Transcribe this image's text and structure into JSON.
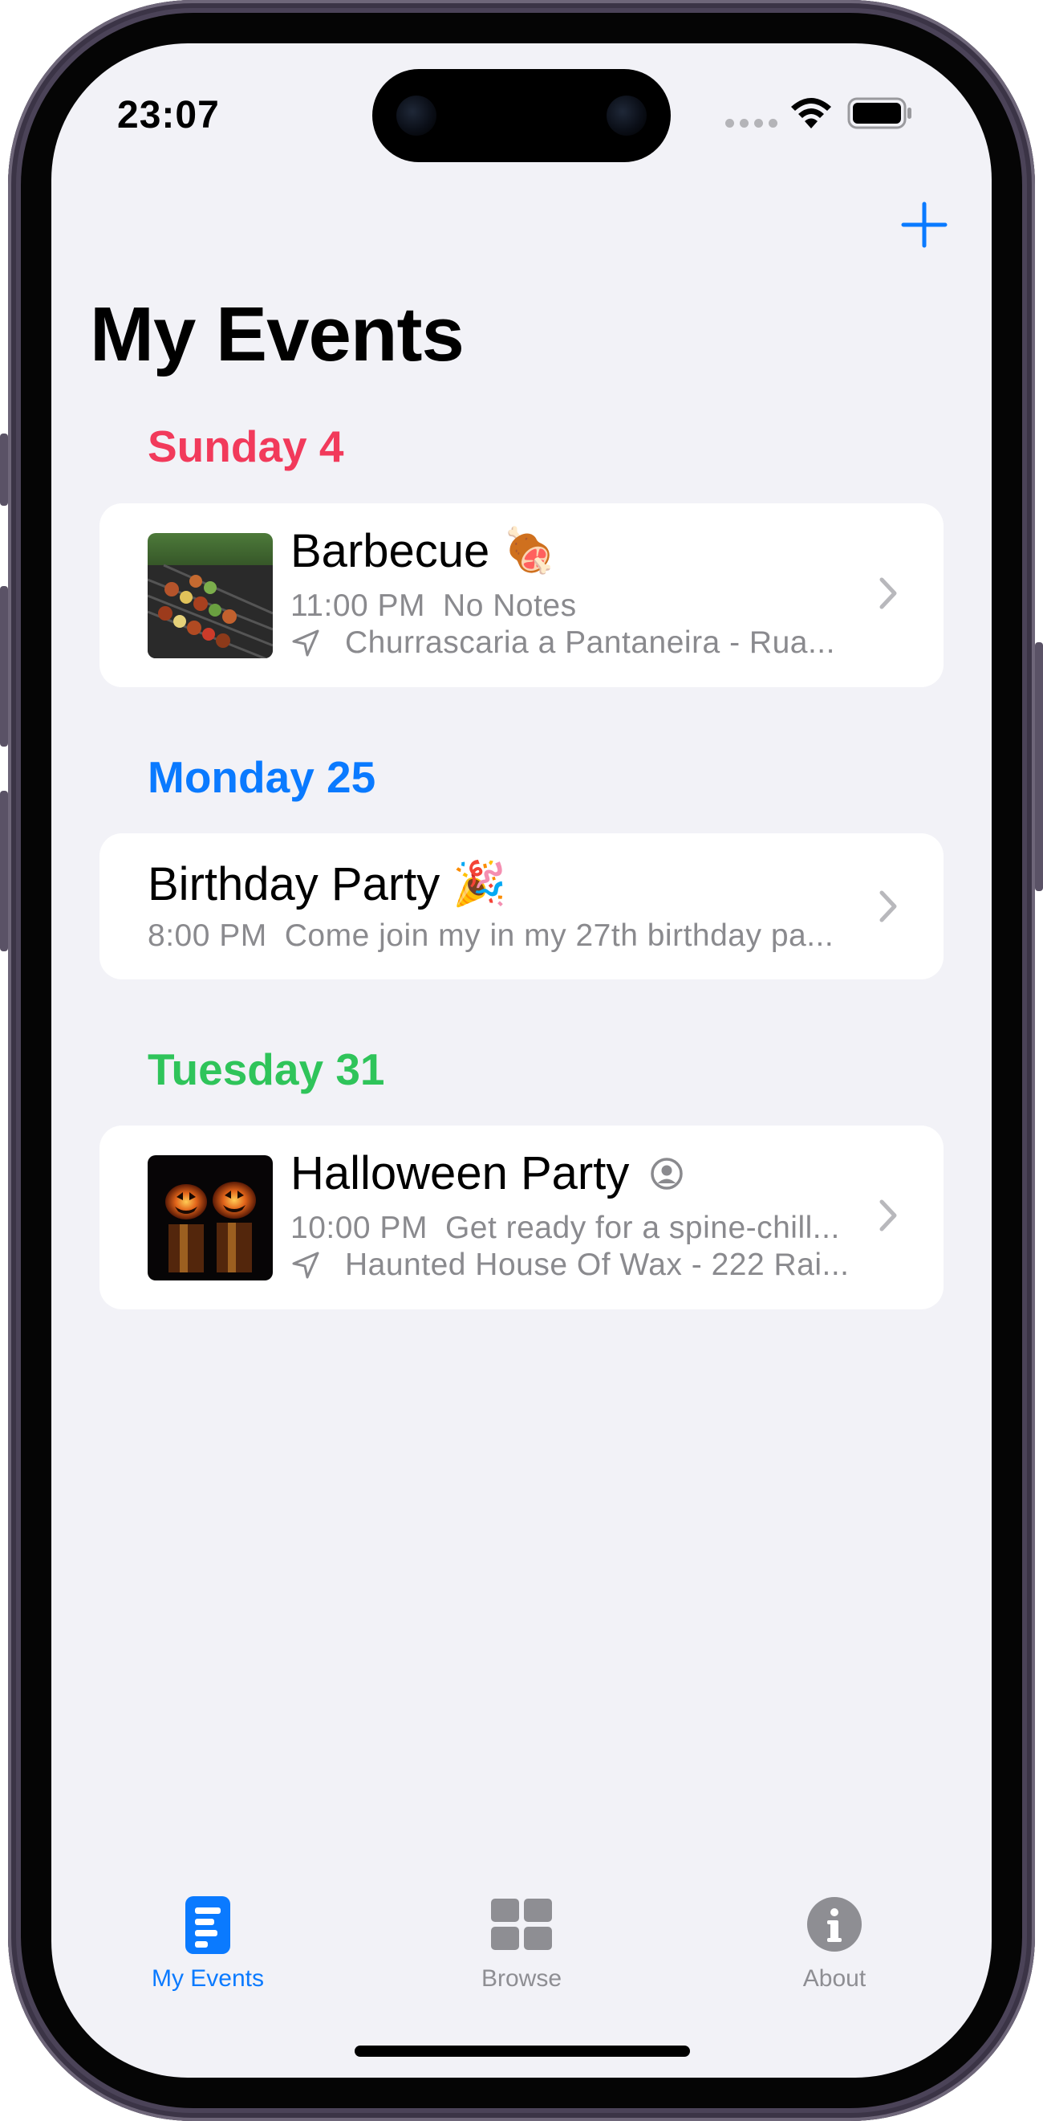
{
  "status_bar": {
    "time": "23:07"
  },
  "nav": {
    "title": "My Events",
    "add_icon": "plus-icon"
  },
  "colors": {
    "accent": "#0a7aff",
    "sunday": "#f23a5b",
    "monday": "#0a7aff",
    "tuesday": "#2fc45a",
    "secondary_text": "#8a8a8e",
    "tab_inactive": "#8e8e93"
  },
  "sections": [
    {
      "header": "Sunday 4",
      "event": {
        "title": "Barbecue",
        "emoji": "🍖",
        "time": "11:00 PM",
        "notes": "No Notes",
        "location": "Churrascaria a Pantaneira - Rua..."
      }
    },
    {
      "header": "Monday 25",
      "event": {
        "title": "Birthday Party",
        "emoji": "🎉",
        "time": "8:00 PM",
        "notes": "Come join my in my 27th birthday pa..."
      }
    },
    {
      "header": "Tuesday 31",
      "event": {
        "title": "Halloween Party",
        "icon": "person-circle-icon",
        "time": "10:00 PM",
        "notes": "Get ready for a spine-chill...",
        "location": "Haunted House Of Wax - 222 Rai..."
      }
    }
  ],
  "tab_bar": {
    "items": [
      {
        "label": "My Events",
        "icon": "list-doc-icon",
        "selected": true
      },
      {
        "label": "Browse",
        "icon": "grid-icon",
        "selected": false
      },
      {
        "label": "About",
        "icon": "info-icon",
        "selected": false
      }
    ]
  }
}
